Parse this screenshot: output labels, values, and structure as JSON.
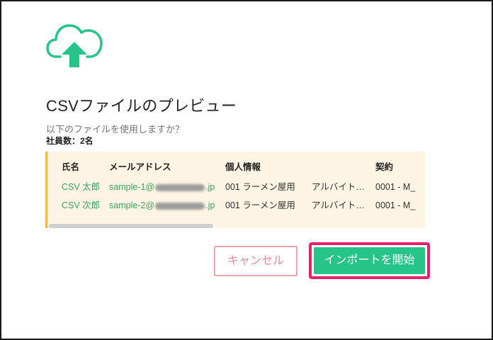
{
  "dialog": {
    "title": "CSVファイルのプレビュー",
    "question": "以下のファイルを使用しますか？",
    "employee_count": "社員数：2名",
    "icon": "cloud-upload-icon",
    "accent_color": "#27c489"
  },
  "table": {
    "headers": [
      "氏名",
      "メールアドレス",
      "個人情報",
      "",
      "契約"
    ],
    "rows": [
      {
        "name": "CSV 太郎",
        "email_prefix": "sample-1@",
        "email_suffix": ".jp",
        "info": "001 ラーメン屋用",
        "info2": "アルバイト…",
        "contract": "0001 - M_"
      },
      {
        "name": "CSV 次郎",
        "email_prefix": "sample-2@",
        "email_suffix": ".jp",
        "info": "001 ラーメン屋用",
        "info2": "アルバイト…",
        "contract": "0001 - M_"
      }
    ]
  },
  "buttons": {
    "cancel": "キャンセル",
    "start": "インポートを開始"
  },
  "colors": {
    "cancel_border": "#eca6ae",
    "start_bg": "#27c489",
    "highlight": "#e8206b",
    "preview_bg": "#fdf4e3"
  }
}
